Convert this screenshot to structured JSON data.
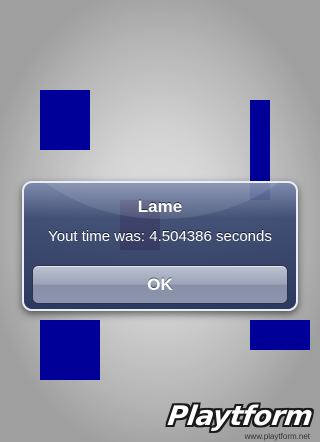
{
  "game": {
    "block_color": "#0000ad",
    "target_color": "#8a0a2e"
  },
  "alert": {
    "title": "Lame",
    "message": "Yout time was: 4.504386 seconds",
    "ok_label": "OK"
  },
  "watermark": {
    "logo_text": "Playtform",
    "url": "www.playtform.net"
  }
}
